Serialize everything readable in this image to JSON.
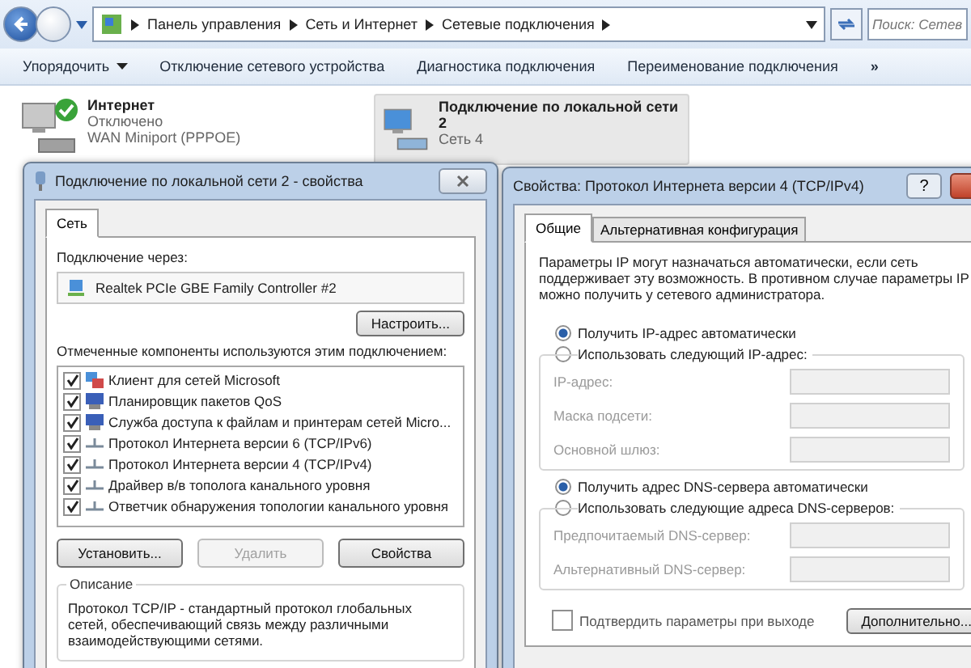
{
  "address_bar": {
    "path": [
      "Панель управления",
      "Сеть и Интернет",
      "Сетевые подключения"
    ]
  },
  "search": {
    "placeholder": "Поиск: Сетев"
  },
  "toolbar": [
    {
      "label": "Упорядочить",
      "kind": "menu"
    },
    {
      "label": "Отключение сетевого устройства",
      "kind": "button"
    },
    {
      "label": "Диагностика подключения",
      "kind": "button"
    },
    {
      "label": "Переименование подключения",
      "kind": "button"
    },
    {
      "label": "»",
      "kind": "more"
    }
  ],
  "connections": [
    {
      "name": "Интернет",
      "status": "Отключено",
      "device": "WAN Miniport (PPPOE)",
      "kind": "dialup",
      "checkmark": true,
      "selected": false
    },
    {
      "name": "Подключение по локальной сети 2",
      "status": "Сеть 4",
      "kind": "lan",
      "checkmark": false,
      "selected": true
    }
  ],
  "properties_dialog": {
    "title": "Подключение по локальной сети 2 - свойства",
    "tabs": [
      {
        "label": "Сеть",
        "selected": true
      }
    ],
    "connect_via_label": "Подключение через:",
    "adapter": "Realtek PCIe GBE Family Controller #2",
    "configure_button": "Настроить...",
    "components_label": "Отмеченные компоненты используются этим подключением:",
    "components": [
      {
        "label": "Клиент для сетей Microsoft",
        "kind": "client",
        "checked": true
      },
      {
        "label": "Планировщик пакетов QoS",
        "kind": "service",
        "checked": true
      },
      {
        "label": "Служба доступа к файлам и принтерам сетей Micro...",
        "kind": "service",
        "checked": true
      },
      {
        "label": "Протокол Интернета версии 6 (TCP/IPv6)",
        "kind": "protocol",
        "checked": true
      },
      {
        "label": "Протокол Интернета версии 4 (TCP/IPv4)",
        "kind": "protocol",
        "checked": true
      },
      {
        "label": "Драйвер в/в тополога канального уровня",
        "kind": "protocol",
        "checked": true
      },
      {
        "label": "Ответчик обнаружения топологии канального уровня",
        "kind": "protocol",
        "checked": true
      }
    ],
    "buttons": [
      {
        "label": "Установить...",
        "disabled": false
      },
      {
        "label": "Удалить",
        "disabled": true
      },
      {
        "label": "Свойства",
        "disabled": false
      }
    ],
    "description_title": "Описание",
    "description": "Протокол TCP/IP - стандартный протокол глобальных сетей, обеспечивающий связь между различными взаимодействующими сетями."
  },
  "ipv4_dialog": {
    "title": "Свойства: Протокол Интернета версии 4 (TCP/IPv4)",
    "help_button": "?",
    "tabs": [
      {
        "label": "Общие",
        "selected": true
      },
      {
        "label": "Альтернативная конфигурация",
        "selected": false
      }
    ],
    "intro": "Параметры IP могут назначаться автоматически, если сеть поддерживает эту возможность. В противном случае параметры IP можно получить у сетевого администратора.",
    "ip_options": [
      {
        "label": "Получить IP-адрес автоматически",
        "selected": true
      },
      {
        "label": "Использовать следующий IP-адрес:",
        "selected": false
      }
    ],
    "ip_fields": [
      {
        "label": "IP-адрес:",
        "disabled": true
      },
      {
        "label": "Маска подсети:",
        "disabled": true
      },
      {
        "label": "Основной шлюз:",
        "disabled": true
      }
    ],
    "dns_options": [
      {
        "label": "Получить адрес DNS-сервера автоматически",
        "selected": true
      },
      {
        "label": "Использовать следующие адреса DNS-серверов:",
        "selected": false
      }
    ],
    "dns_fields": [
      {
        "label": "Предпочитаемый DNS-сервер:",
        "disabled": true
      },
      {
        "label": "Альтернативный DNS-сервер:",
        "disabled": true
      }
    ],
    "validate": {
      "label": "Подтвердить параметры при выходе",
      "checked": false
    },
    "advanced_button": "Дополнительно..."
  }
}
